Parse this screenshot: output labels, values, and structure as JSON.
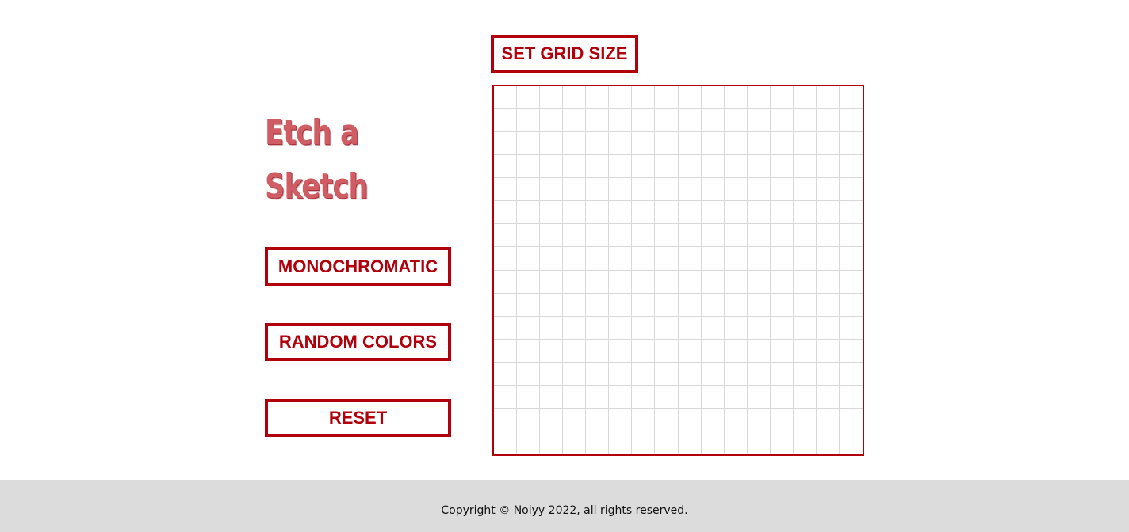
{
  "app": {
    "title_line1": "Etch a",
    "title_line2": "Sketch"
  },
  "controls": {
    "set_grid_size_label": "SET GRID SIZE",
    "monochromatic_label": "MONOCHROMATIC",
    "random_colors_label": "RANDOM COLORS",
    "reset_label": "RESET"
  },
  "grid": {
    "rows": 16,
    "columns": 16
  },
  "footer": {
    "prefix": "Copyright © ",
    "author_link": "Noiyy ",
    "suffix": "2022, all rights reserved."
  },
  "colors": {
    "accent": "#b0000b",
    "title": "#d05c64",
    "grid_line": "#d8d8d8",
    "footer_bg": "#dcdcdc"
  }
}
